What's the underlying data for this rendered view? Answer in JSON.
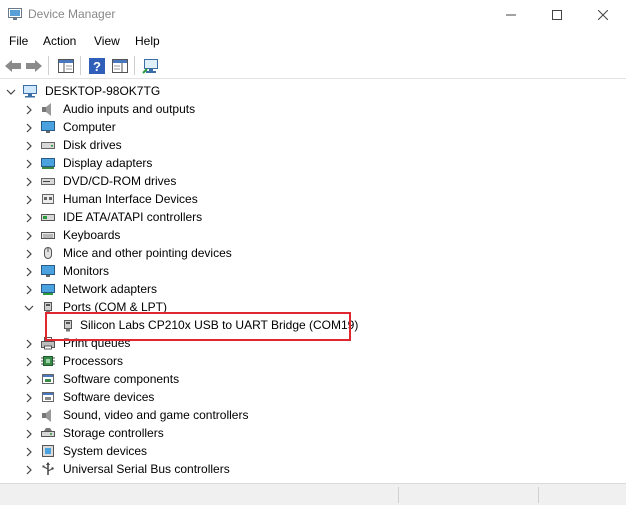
{
  "window": {
    "title": "Device Manager",
    "controls": {
      "minimize": "—",
      "maximize": "☐",
      "close": "✕"
    }
  },
  "menu": [
    "File",
    "Action",
    "View",
    "Help"
  ],
  "toolbar": {
    "buttons": [
      "back-icon",
      "forward-icon",
      "show-hide-console-tree-icon",
      "help-icon",
      "properties-pane-icon",
      "scan-hardware-icon"
    ]
  },
  "tree": {
    "root": {
      "label": "DESKTOP-98OK7TG",
      "icon": "computer-icon",
      "expanded": true
    },
    "categories": [
      {
        "label": "Audio inputs and outputs",
        "icon": "speaker-icon",
        "expanded": false
      },
      {
        "label": "Computer",
        "icon": "monitor-icon",
        "expanded": false
      },
      {
        "label": "Disk drives",
        "icon": "disk-drive-icon",
        "expanded": false
      },
      {
        "label": "Display adapters",
        "icon": "display-adapter-icon",
        "expanded": false
      },
      {
        "label": "DVD/CD-ROM drives",
        "icon": "dvd-drive-icon",
        "expanded": false
      },
      {
        "label": "Human Interface Devices",
        "icon": "hid-icon",
        "expanded": false
      },
      {
        "label": "IDE ATA/ATAPI controllers",
        "icon": "ide-controller-icon",
        "expanded": false
      },
      {
        "label": "Keyboards",
        "icon": "keyboard-icon",
        "expanded": false
      },
      {
        "label": "Mice and other pointing devices",
        "icon": "mouse-icon",
        "expanded": false
      },
      {
        "label": "Monitors",
        "icon": "monitor-icon",
        "expanded": false
      },
      {
        "label": "Network adapters",
        "icon": "network-adapter-icon",
        "expanded": false
      },
      {
        "label": "Ports (COM & LPT)",
        "icon": "port-icon",
        "expanded": true,
        "children": [
          {
            "label": "Silicon Labs CP210x USB to UART Bridge (COM19)",
            "icon": "port-icon",
            "highlighted": true
          }
        ]
      },
      {
        "label": "Print queues",
        "icon": "printer-icon",
        "expanded": false
      },
      {
        "label": "Processors",
        "icon": "processor-icon",
        "expanded": false
      },
      {
        "label": "Software components",
        "icon": "software-component-icon",
        "expanded": false
      },
      {
        "label": "Software devices",
        "icon": "software-device-icon",
        "expanded": false
      },
      {
        "label": "Sound, video and game controllers",
        "icon": "speaker-icon",
        "expanded": false
      },
      {
        "label": "Storage controllers",
        "icon": "storage-controller-icon",
        "expanded": false
      },
      {
        "label": "System devices",
        "icon": "system-device-icon",
        "expanded": false
      },
      {
        "label": "Universal Serial Bus controllers",
        "icon": "usb-icon",
        "expanded": false
      }
    ]
  },
  "colors": {
    "highlight_border": "#e0262e",
    "title_text": "#888888",
    "status_bar": "#f0f0f0"
  }
}
